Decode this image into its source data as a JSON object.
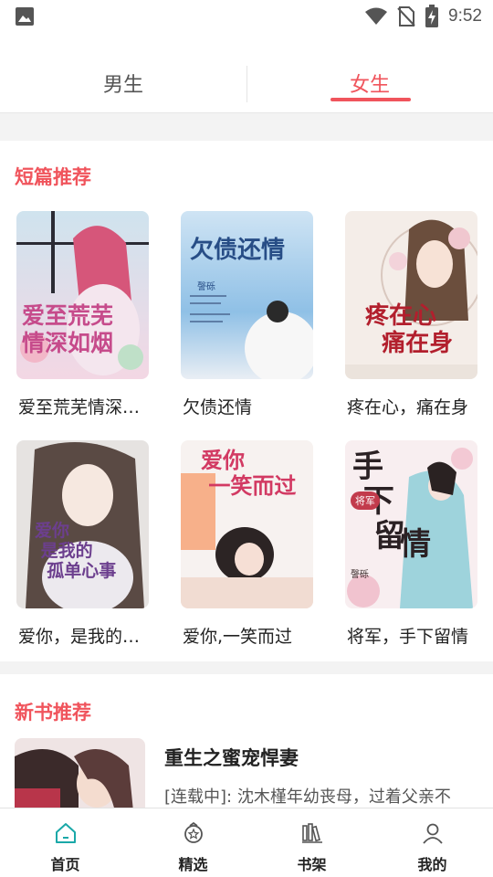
{
  "status_bar": {
    "time": "9:52",
    "icons": [
      "image-icon",
      "wifi-icon",
      "no-sim-icon",
      "battery-charging-icon"
    ]
  },
  "tabs": [
    {
      "label": "男生",
      "active": false
    },
    {
      "label": "女生",
      "active": true
    }
  ],
  "colors": {
    "accent": "#f0545c",
    "nav_active": "#1aa8a8",
    "text": "#222222",
    "band": "#f3f3f3"
  },
  "short_section": {
    "title": "短篇推荐",
    "books": [
      {
        "title": "爱至荒芜情深…",
        "cover_text": "爱至荒芜情深如烟"
      },
      {
        "title": "欠债还情",
        "cover_text": "欠债还情",
        "cover_author": "謦砾"
      },
      {
        "title": "疼在心，痛在身",
        "cover_text": "疼在心痛在身"
      },
      {
        "title": "爱你，是我的…",
        "cover_text": "爱你是我的孤单心事"
      },
      {
        "title": "爱你,一笑而过",
        "cover_text": "爱你一笑而过"
      },
      {
        "title": "将军，手下留情",
        "cover_text": "手下留情",
        "cover_tag": "将军",
        "cover_author": "謦砾"
      }
    ]
  },
  "new_section": {
    "title": "新书推荐",
    "book": {
      "title": "重生之蜜宠悍妻",
      "desc": "[连载中]:   沈木槿年幼丧母，过着父亲不"
    }
  },
  "bottom_nav": [
    {
      "label": "首页",
      "icon": "home-icon",
      "active": true
    },
    {
      "label": "精选",
      "icon": "featured-icon",
      "active": false
    },
    {
      "label": "书架",
      "icon": "bookshelf-icon",
      "active": false
    },
    {
      "label": "我的",
      "icon": "profile-icon",
      "active": false
    }
  ]
}
